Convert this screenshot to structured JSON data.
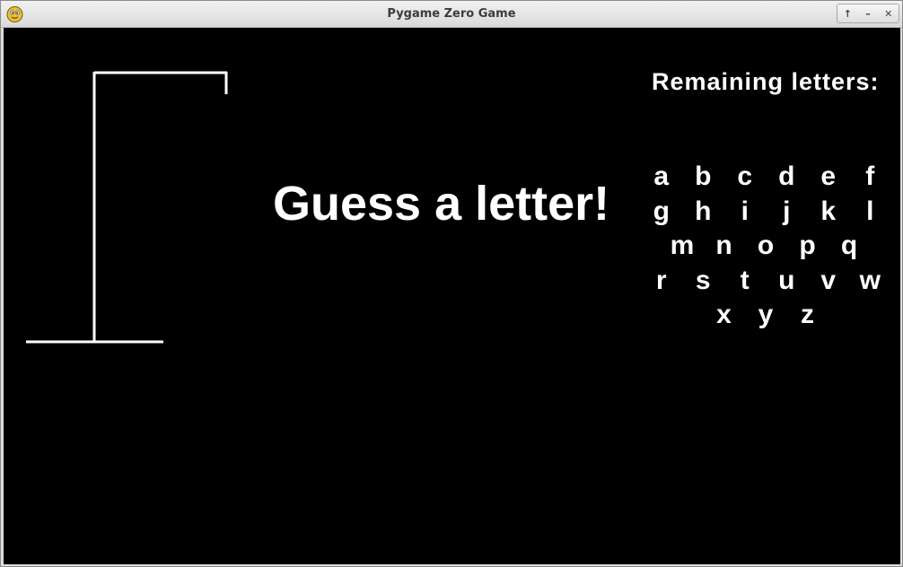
{
  "window": {
    "title": "Pygame Zero Game",
    "controls": {
      "maximize": "↑",
      "minimize": "–",
      "close": "✕"
    }
  },
  "game": {
    "prompt": "Guess a letter!",
    "remaining_label": "Remaining letters:",
    "remaining_letters": [
      [
        "a",
        "b",
        "c",
        "d",
        "e",
        "f"
      ],
      [
        "g",
        "h",
        "i",
        "j",
        "k",
        "l"
      ],
      [
        "m",
        "n",
        "o",
        "p",
        "q"
      ],
      [
        "r",
        "s",
        "t",
        "u",
        "v",
        "w"
      ],
      [
        "x",
        "y",
        "z"
      ]
    ],
    "colors": {
      "background": "#000000",
      "foreground": "#ffffff"
    }
  }
}
